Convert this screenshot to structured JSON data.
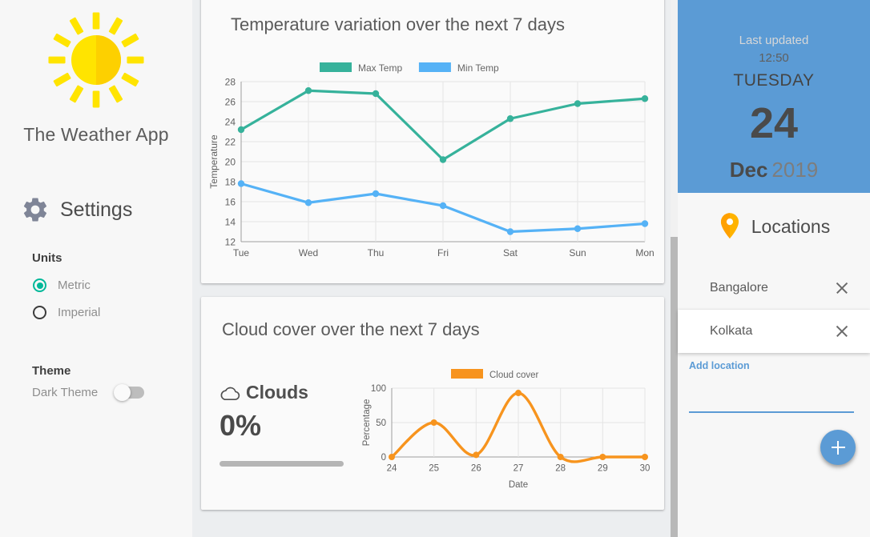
{
  "app": {
    "title": "The Weather App",
    "logo_icon": "sun-icon"
  },
  "sidebar": {
    "settings_title": "Settings",
    "settings_icon": "gear-icon",
    "units": {
      "label": "Units",
      "options": [
        {
          "label": "Metric",
          "selected": true
        },
        {
          "label": "Imperial",
          "selected": false
        }
      ]
    },
    "theme": {
      "label": "Theme",
      "toggle_label": "Dark Theme",
      "toggle_on": false
    }
  },
  "main": {
    "temp_card_title": "Temperature variation over the next 7 days",
    "cloud_card_title": "Cloud cover over the next 7 days",
    "clouds": {
      "icon": "cloud-icon",
      "label": "Clouds",
      "value": "0%",
      "progress_percent": 0
    }
  },
  "right_panel": {
    "last_updated_label": "Last updated",
    "last_updated_time": "12:50",
    "day_name": "TUESDAY",
    "day_number": "24",
    "month": "Dec",
    "year": "2019",
    "locations_title": "Locations",
    "locations_icon": "map-pin-icon",
    "locations": [
      {
        "name": "Bangalore",
        "selected": false
      },
      {
        "name": "Kolkata",
        "selected": true
      }
    ],
    "add_location_label": "Add location",
    "add_location_value": "",
    "add_location_placeholder": "",
    "fab_icon": "plus-icon"
  },
  "colors": {
    "accent_blue": "#5b9bd5",
    "max_temp": "#36b29b",
    "min_temp": "#55b2f6",
    "cloud_orange": "#f7941e",
    "radio_on": "#00b899",
    "sun_light": "#ffe400",
    "sun_dark": "#fdd000",
    "pin_orange": "#fbb034"
  },
  "chart_data": [
    {
      "id": "temperature-chart",
      "type": "line",
      "title": "Temperature variation over the next 7 days",
      "xlabel": "",
      "ylabel": "Temperature",
      "categories": [
        "Tue",
        "Wed",
        "Thu",
        "Fri",
        "Sat",
        "Sun",
        "Mon"
      ],
      "ylim": [
        12,
        28
      ],
      "yticks": [
        12,
        14,
        16,
        18,
        20,
        22,
        24,
        26,
        28
      ],
      "grid": true,
      "legend_position": "top",
      "series": [
        {
          "name": "Max Temp",
          "color": "#36b29b",
          "values": [
            23.2,
            27.1,
            26.8,
            20.2,
            24.3,
            25.8,
            26.3
          ]
        },
        {
          "name": "Min Temp",
          "color": "#55b2f6",
          "values": [
            17.8,
            15.9,
            16.8,
            15.6,
            13.0,
            13.3,
            13.8
          ]
        }
      ]
    },
    {
      "id": "cloud-cover-chart",
      "type": "line",
      "title": "Cloud cover over the next 7 days",
      "xlabel": "Date",
      "ylabel": "Percentage",
      "categories": [
        "24",
        "25",
        "26",
        "27",
        "28",
        "29",
        "30"
      ],
      "ylim": [
        0,
        100
      ],
      "yticks": [
        0,
        50,
        100
      ],
      "grid": true,
      "legend_position": "top",
      "series": [
        {
          "name": "Cloud cover",
          "color": "#f7941e",
          "values": [
            0,
            50,
            3,
            93,
            0,
            0,
            0
          ]
        }
      ]
    }
  ]
}
